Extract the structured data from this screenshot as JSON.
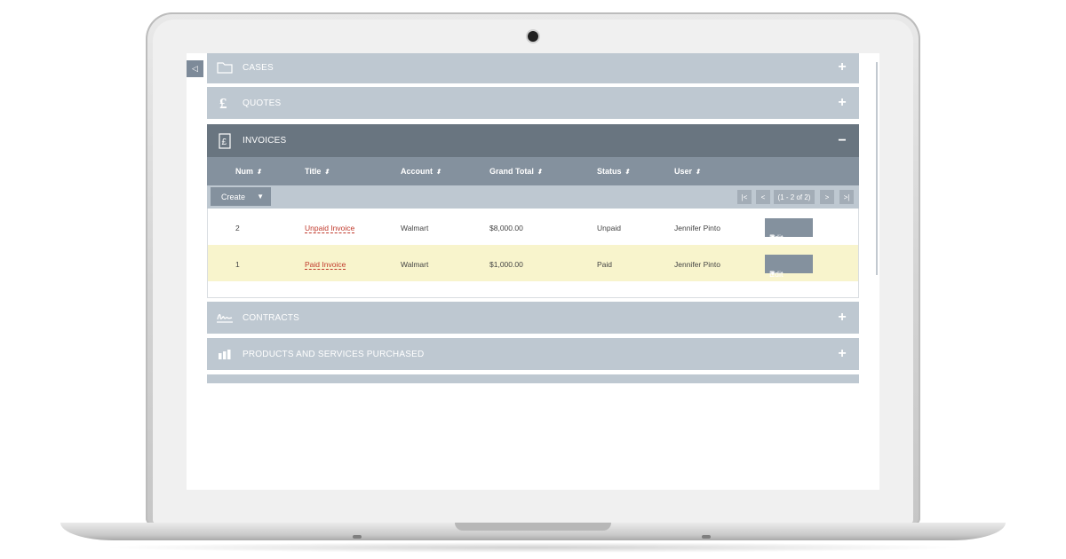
{
  "sidebar_toggle": "◁",
  "panels": {
    "cases": {
      "label": "CASES",
      "toggle": "+"
    },
    "quotes": {
      "label": "QUOTES",
      "toggle": "+"
    },
    "invoices": {
      "label": "INVOICES",
      "toggle": "−"
    },
    "contracts": {
      "label": "CONTRACTS",
      "toggle": "+"
    },
    "products": {
      "label": "PRODUCTS AND SERVICES PURCHASED",
      "toggle": "+"
    }
  },
  "invoices_table": {
    "columns": [
      "Num",
      "Title",
      "Account",
      "Grand Total",
      "Status",
      "User"
    ],
    "sort_glyph": "⬍",
    "create_label": "Create",
    "dropdown_caret": "▼",
    "pager": {
      "first": "|<",
      "prev": "<",
      "info": "(1 - 2 of 2)",
      "next": ">",
      "last": ">|"
    },
    "rows": [
      {
        "num": "2",
        "title": "Unpaid Invoice",
        "account": "Walmart",
        "grand_total": "$8,000.00",
        "status": "Unpaid",
        "user": "Jennifer Pinto",
        "action": "Edit"
      },
      {
        "num": "1",
        "title": "Paid Invoice",
        "account": "Walmart",
        "grand_total": "$1,000.00",
        "status": "Paid",
        "user": "Jennifer Pinto",
        "action": "Edit"
      }
    ]
  },
  "colors": {
    "panel_collapsed": "#bec8d1",
    "panel_open": "#697580",
    "column_header": "#84919e",
    "row_highlight": "#f8f4cc",
    "link": "#c0392b"
  }
}
